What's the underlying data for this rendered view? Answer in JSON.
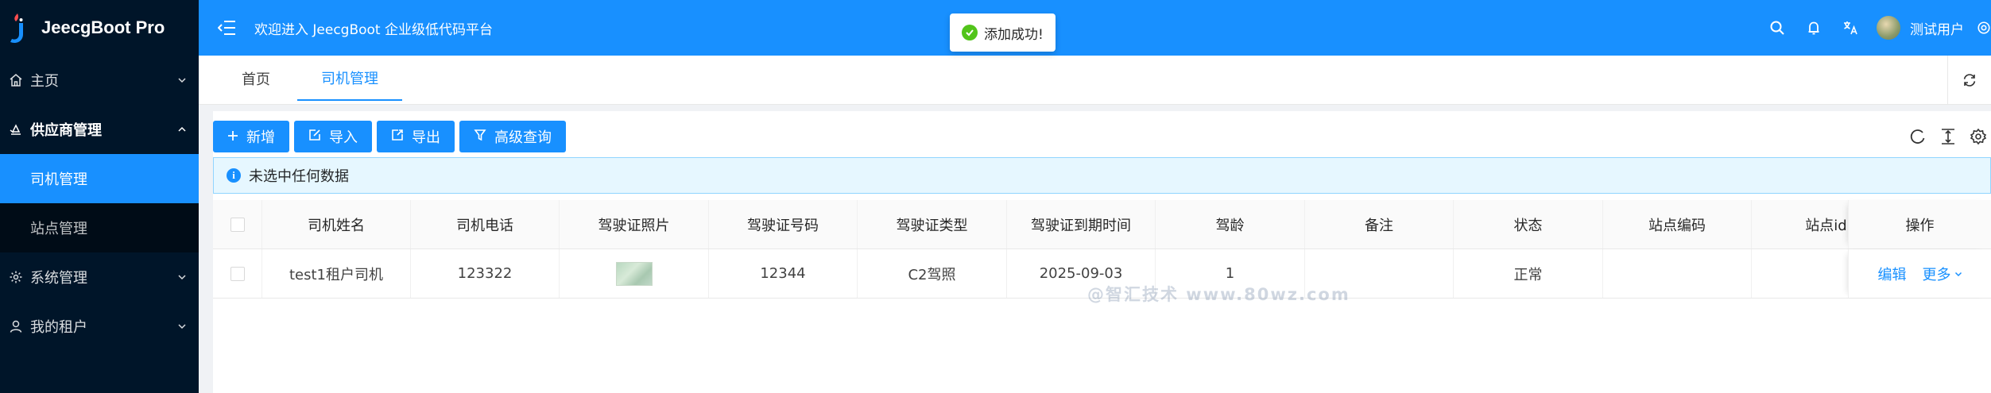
{
  "app": {
    "name": "JeecgBoot Pro"
  },
  "sidebar": {
    "items": [
      {
        "label": "主页",
        "icon": "home-icon"
      },
      {
        "label": "供应商管理",
        "icon": "supplier-icon",
        "children": [
          {
            "label": "司机管理"
          },
          {
            "label": "站点管理"
          }
        ]
      },
      {
        "label": "系统管理",
        "icon": "gear-icon"
      },
      {
        "label": "我的租户",
        "icon": "user-icon"
      }
    ]
  },
  "header": {
    "welcome": "欢迎进入 JeecgBoot 企业级低代码平台",
    "username": "测试用户"
  },
  "toast": {
    "message": "添加成功!"
  },
  "tabs": [
    {
      "label": "首页"
    },
    {
      "label": "司机管理"
    }
  ],
  "toolbar": {
    "add": "新增",
    "import": "导入",
    "export": "导出",
    "advanced": "高级查询"
  },
  "alert": {
    "text": "未选中任何数据"
  },
  "watermark": "@智汇技术 www.80wz.com",
  "table": {
    "columns": [
      "司机姓名",
      "司机电话",
      "驾驶证照片",
      "驾驶证号码",
      "驾驶证类型",
      "驾驶证到期时间",
      "驾龄",
      "备注",
      "状态",
      "站点编码",
      "站点id",
      "操作"
    ],
    "rows": [
      {
        "name": "test1租户司机",
        "phone": "123322",
        "license_no": "12344",
        "license_type": "C2驾照",
        "expire": "2025-09-03",
        "years": "1",
        "remark": "",
        "status": "正常",
        "site_code": "",
        "site_id": ""
      }
    ],
    "actions": {
      "edit": "编辑",
      "more": "更多"
    }
  },
  "colors": {
    "primary": "#1890ff",
    "sidebar_bg": "#001529",
    "success": "#52c41a"
  }
}
